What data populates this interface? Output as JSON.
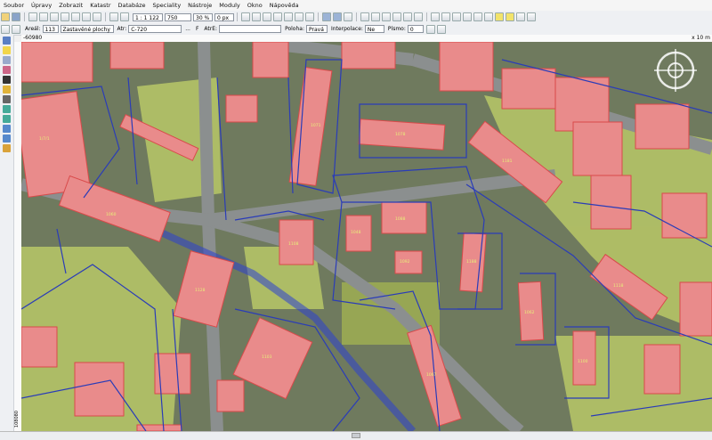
{
  "menu": [
    "Soubor",
    "Úpravy",
    "Zobrazit",
    "Katastr",
    "Databáze",
    "Speciality",
    "Nástroje",
    "Moduly",
    "Okno",
    "Nápověda"
  ],
  "toolbar1": {
    "scale_value": "1 : 1 122",
    "scale_alt": "750",
    "opacity_value": "30 %",
    "offset_value": "0 px"
  },
  "toolbar2": {
    "areal_label": "Areál:",
    "areal_value": "113",
    "layer_value": "Zastavěné plochy a n",
    "attr_label": "Atr:",
    "attr_value": "C-720",
    "more_label": "...",
    "f_label": "F",
    "attre_label": "AtrE:",
    "polisha_label": "Poloha:",
    "polisha_value": "Pravá",
    "interp_label": "Interpolace:",
    "interp_value": "Ne",
    "pismo_label": "Písmo:",
    "pismo_value": "0"
  },
  "ruler": {
    "left_coord": "-60980",
    "right_label": "x 10 m"
  },
  "left_ruler_label": "108080",
  "colors": {
    "parcel_fill": "#e98b8b",
    "parcel_stroke": "#d94a4a",
    "boundary": "#2a3cb8",
    "vegetation": "#b9c867",
    "road": "#7b7f80"
  },
  "map_labels": [
    "1/7/1",
    "1060",
    "1071",
    "1078",
    "1048",
    "1088",
    "1092",
    "1108",
    "1181",
    "1188",
    "1062",
    "1100",
    "1118",
    "1067",
    "1128",
    "1103"
  ]
}
